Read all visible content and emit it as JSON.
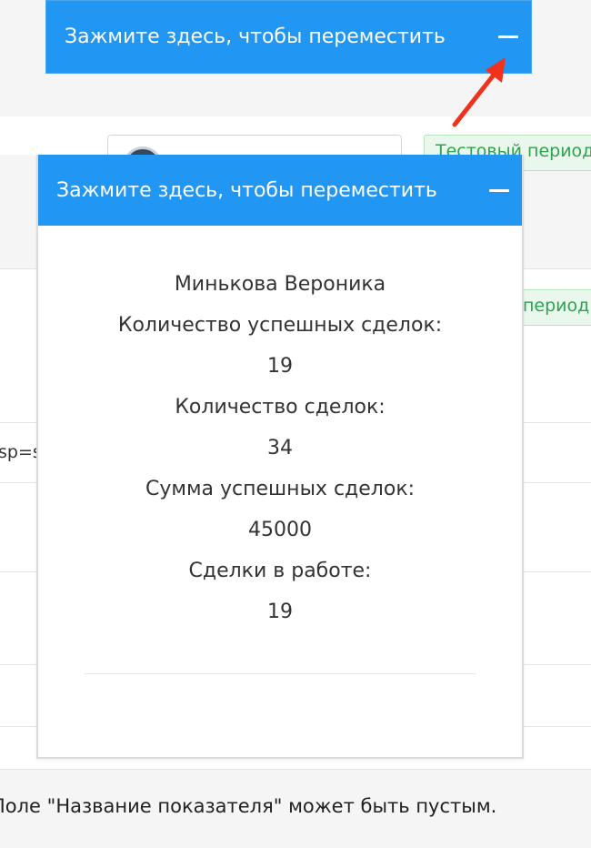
{
  "drag_widget_top": {
    "title": "Зажмите здесь, чтобы переместить"
  },
  "drag_widget": {
    "title": "Зажмите здесь, чтобы переместить",
    "user_name": "Минькова Вероника",
    "stats": [
      {
        "label": "Количество успешных сделок:",
        "value": "19"
      },
      {
        "label": "Количество сделок:",
        "value": "34"
      },
      {
        "label": "Сумма успешных сделок:",
        "value": "45000"
      },
      {
        "label": "Сделки в работе:",
        "value": "19"
      }
    ]
  },
  "background": {
    "trial_badge_1": "Тестовый период",
    "trial_badge_2": "период",
    "url_fragment": "sp=s",
    "footer_note": "Поле \"Название показателя\" может быть пустым."
  },
  "colors": {
    "header_blue": "#2196f3",
    "arrow_red": "#f2311d",
    "badge_green": "#2fa352"
  }
}
